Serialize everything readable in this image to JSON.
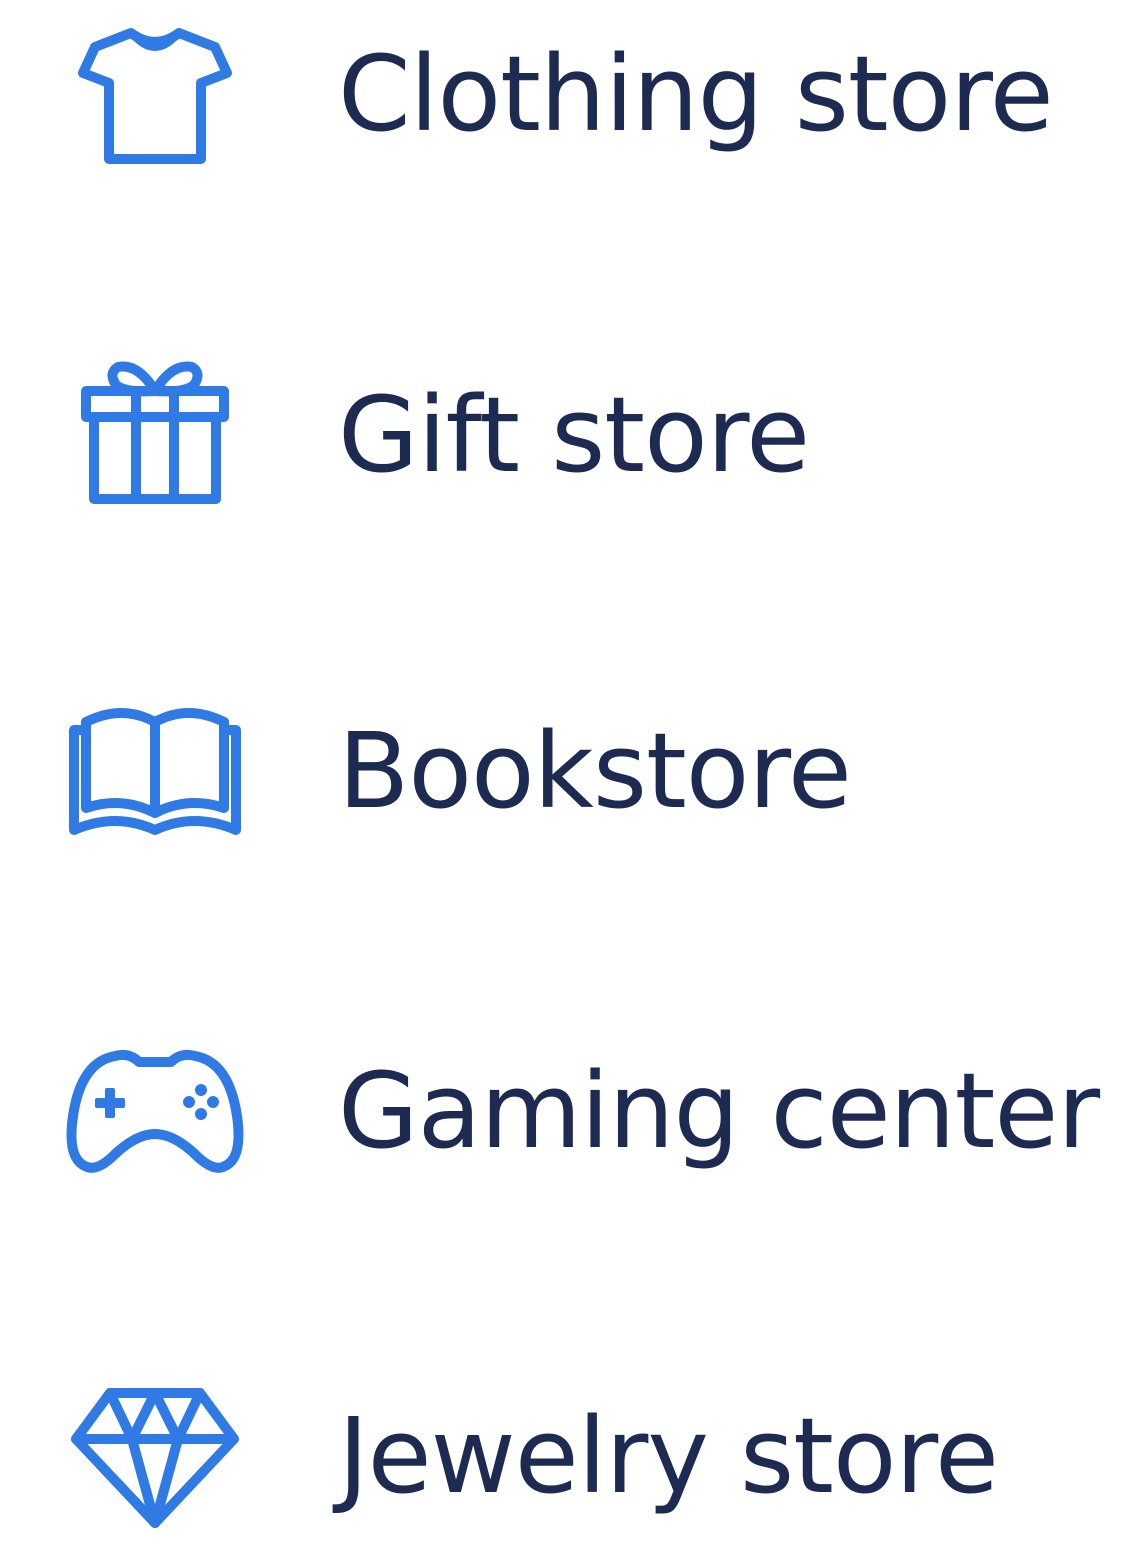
{
  "categories": [
    {
      "icon": "t-shirt-icon",
      "label": "Clothing store"
    },
    {
      "icon": "gift-icon",
      "label": "Gift store"
    },
    {
      "icon": "open-book-icon",
      "label": "Bookstore"
    },
    {
      "icon": "game-controller-icon",
      "label": "Gaming center"
    },
    {
      "icon": "diamond-icon",
      "label": "Jewelry store"
    }
  ],
  "colors": {
    "icon": "#2f7ae5",
    "text": "#1d2a52",
    "background": "#ffffff"
  }
}
